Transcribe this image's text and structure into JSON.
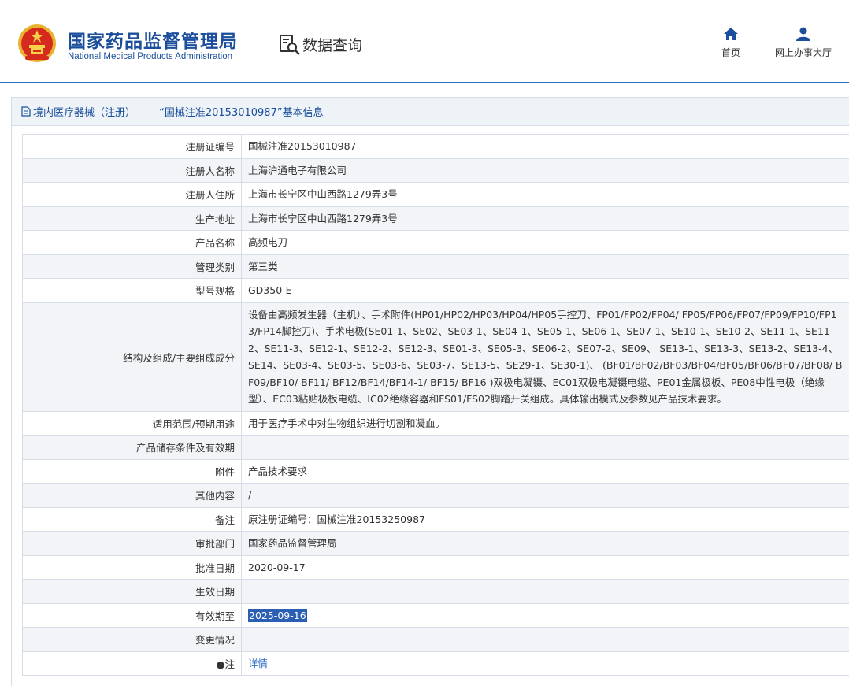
{
  "header": {
    "brand_cn": "国家药品监督管理局",
    "brand_en": "National Medical Products Administration",
    "query_label": "数据查询",
    "nav": {
      "home": "首页",
      "service": "网上办事大厅"
    }
  },
  "panel": {
    "title": "境内医疗器械（注册） ——“国械注准20153010987”基本信息"
  },
  "rows": [
    {
      "label": "注册证编号",
      "value": "国械注准20153010987"
    },
    {
      "label": "注册人名称",
      "value": "上海沪通电子有限公司"
    },
    {
      "label": "注册人住所",
      "value": "上海市长宁区中山西路1279弄3号"
    },
    {
      "label": "生产地址",
      "value": "上海市长宁区中山西路1279弄3号"
    },
    {
      "label": "产品名称",
      "value": "高频电刀"
    },
    {
      "label": "管理类别",
      "value": "第三类"
    },
    {
      "label": "型号规格",
      "value": "GD350-E"
    },
    {
      "label": "结构及组成/主要组成成分",
      "value": "设备由高频发生器（主机）、手术附件(HP01/HP02/HP03/HP04/HP05手控刀、FP01/FP02/FP04/ FP05/FP06/FP07/FP09/FP10/FP13/FP14脚控刀)、手术电极(SE01-1、SE02、SE03-1、SE04-1、SE05-1、SE06-1、SE07-1、SE10-1、SE10-2、SE11-1、SE11-2、SE11-3、SE12-1、SE12-2、SE12-3、SE01-3、SE05-3、SE06-2、SE07-2、SE09、 SE13-1、SE13-3、SE13-2、SE13-4、SE14、SE03-4、SE03-5、SE03-6、SE03-7、SE13-5、SE29-1、SE30-1)、 (BF01/BF02/BF03/BF04/BF05/BF06/BF07/BF08/ BF09/BF10/ BF11/ BF12/BF14/BF14-1/ BF15/ BF16 )双极电凝镊、EC01双极电凝镊电缆、PE01金属极板、PE08中性电极（绝缘型）、EC03粘贴极板电缆、IC02绝缘容器和FS01/FS02脚踏开关组成。具体输出模式及参数见产品技术要求。"
    },
    {
      "label": "适用范围/预期用途",
      "value": "用于医疗手术中对生物组织进行切割和凝血。"
    },
    {
      "label": "产品储存条件及有效期",
      "value": ""
    },
    {
      "label": "附件",
      "value": "产品技术要求"
    },
    {
      "label": "其他内容",
      "value": "/"
    },
    {
      "label": "备注",
      "value": "原注册证编号：国械注准20153250987"
    },
    {
      "label": "审批部门",
      "value": "国家药品监督管理局"
    },
    {
      "label": "批准日期",
      "value": "2020-09-17"
    },
    {
      "label": "生效日期",
      "value": ""
    },
    {
      "label": "有效期至",
      "value": "2025-09-16"
    },
    {
      "label": "变更情况",
      "value": ""
    },
    {
      "label": "●注",
      "value": "详情"
    }
  ],
  "colors": {
    "brand_blue": "#1b4f9c",
    "link_blue": "#2a6cc1",
    "highlight": "#2b5fb4",
    "row_alt": "#f2f4f7",
    "border": "#d6dde6"
  },
  "icons": {
    "emblem": "national-emblem-icon",
    "query": "document-search-icon",
    "home": "home-icon",
    "service": "user-icon",
    "title": "document-icon"
  }
}
